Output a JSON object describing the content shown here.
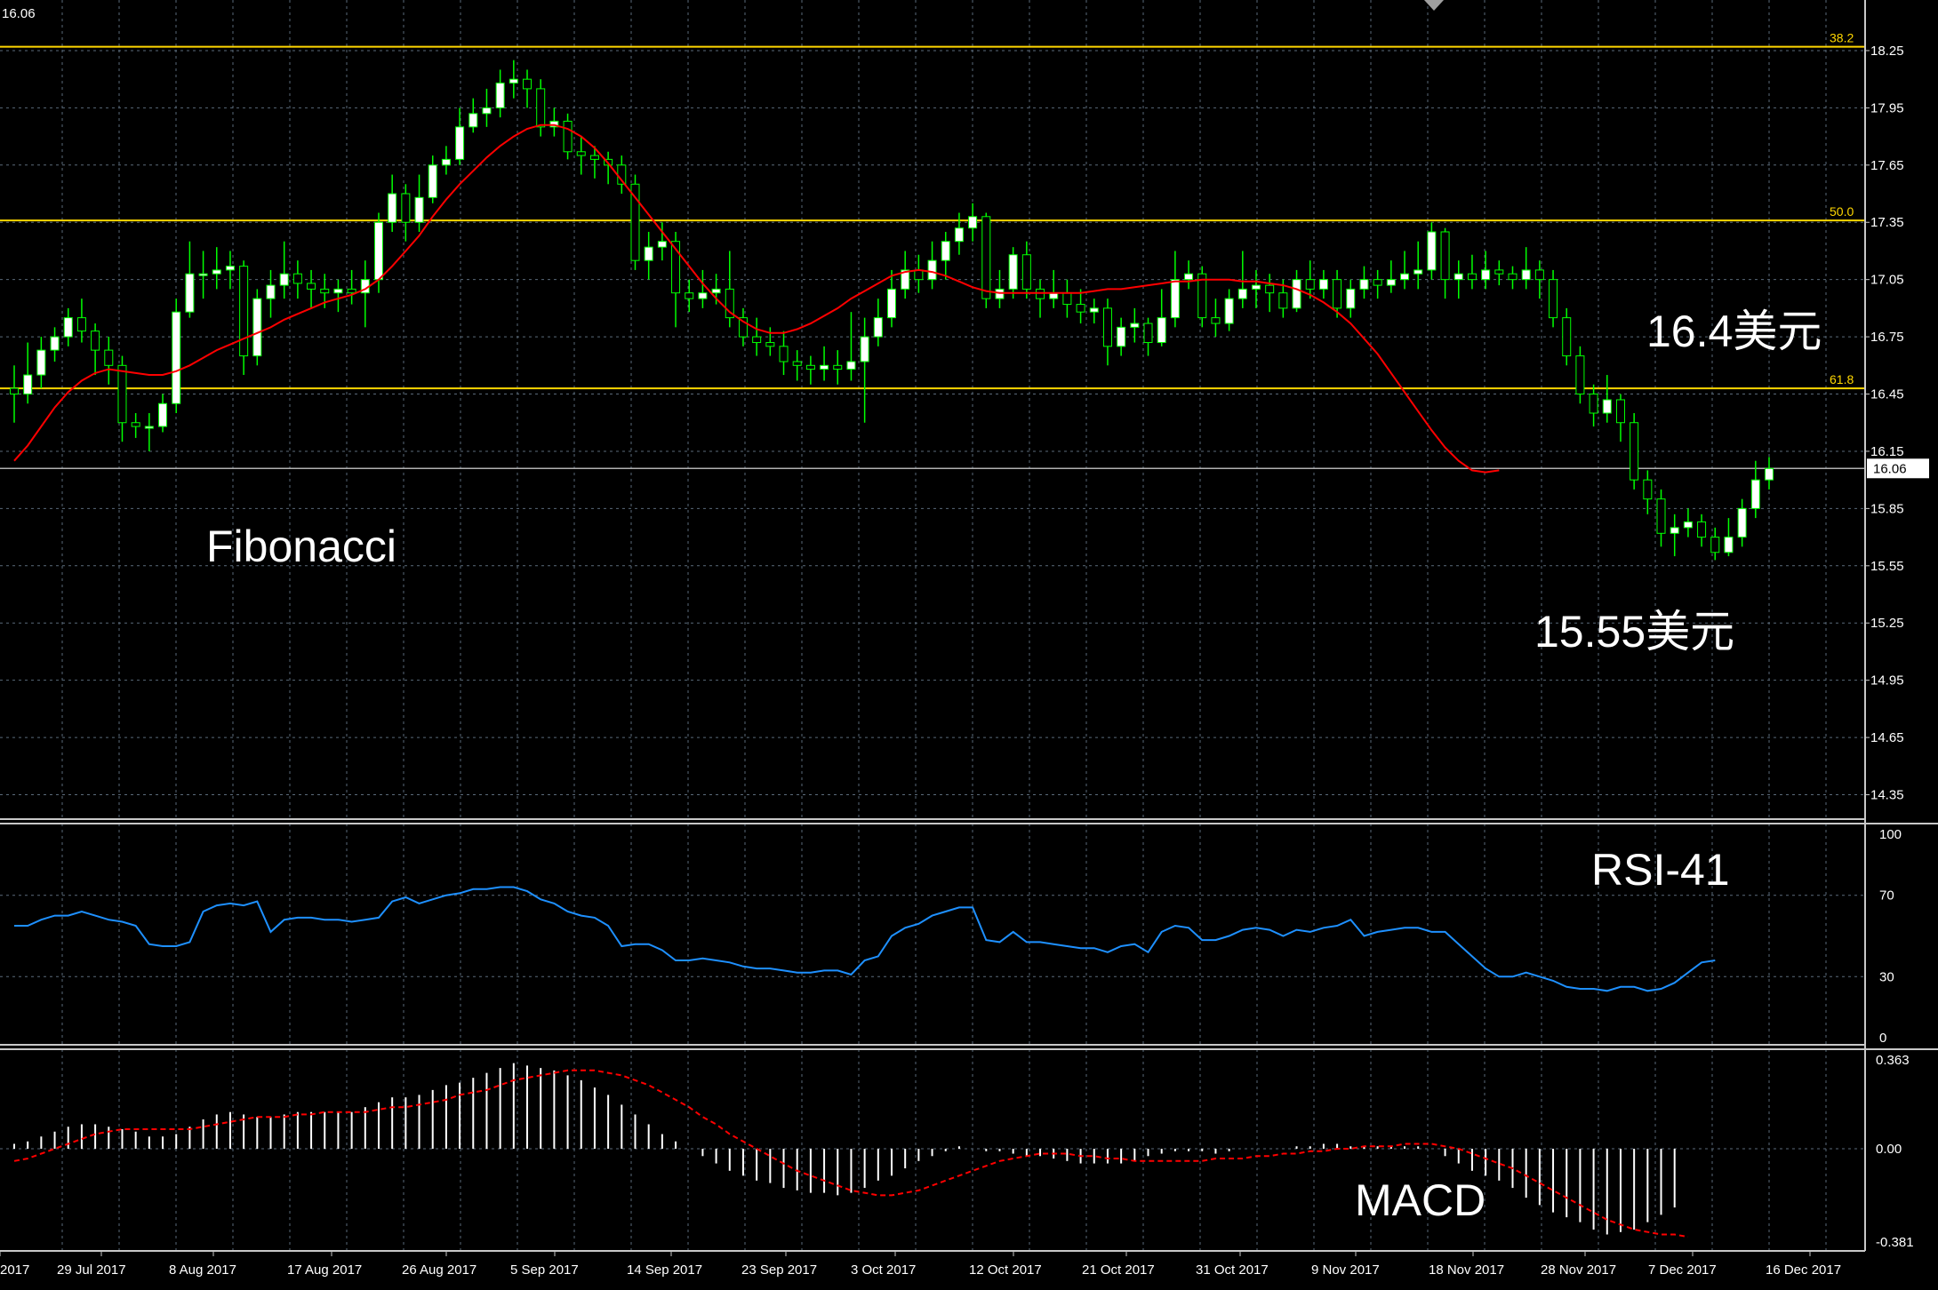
{
  "chart_data": {
    "type": "candlestick",
    "symbol_price_label": "16.06",
    "x_dates": [
      "2017",
      "29 Jul 2017",
      "8 Aug 2017",
      "17 Aug 2017",
      "26 Aug 2017",
      "5 Sep 2017",
      "14 Sep 2017",
      "23 Sep 2017",
      "3 Oct 2017",
      "12 Oct 2017",
      "21 Oct 2017",
      "31 Oct 2017",
      "9 Nov 2017",
      "18 Nov 2017",
      "28 Nov 2017",
      "7 Dec 2017",
      "16 Dec 2017"
    ],
    "price_axis": {
      "ylim": [
        14.25,
        18.45
      ],
      "ticks": [
        "18.25",
        "17.95",
        "17.65",
        "17.35",
        "17.05",
        "16.75",
        "16.45",
        "16.15",
        "15.85",
        "15.55",
        "15.25",
        "14.95",
        "14.65",
        "14.35"
      ],
      "current_price": 16.06,
      "current_label": "16.06"
    },
    "fibonacci": [
      {
        "label": "38.2",
        "price": 18.27
      },
      {
        "label": "50.0",
        "price": 17.36
      },
      {
        "label": "61.8",
        "price": 16.48
      }
    ],
    "candles": [
      [
        16.48,
        16.45,
        16.6,
        16.3
      ],
      [
        16.45,
        16.55,
        16.72,
        16.4
      ],
      [
        16.55,
        16.68,
        16.75,
        16.48
      ],
      [
        16.68,
        16.75,
        16.8,
        16.62
      ],
      [
        16.75,
        16.85,
        16.9,
        16.7
      ],
      [
        16.85,
        16.78,
        16.95,
        16.72
      ],
      [
        16.78,
        16.68,
        16.82,
        16.55
      ],
      [
        16.68,
        16.6,
        16.75,
        16.5
      ],
      [
        16.6,
        16.3,
        16.65,
        16.2
      ],
      [
        16.3,
        16.28,
        16.35,
        16.22
      ],
      [
        16.28,
        16.28,
        16.35,
        16.15
      ],
      [
        16.28,
        16.4,
        16.45,
        16.25
      ],
      [
        16.4,
        16.88,
        16.95,
        16.35
      ],
      [
        16.88,
        17.08,
        17.25,
        16.85
      ],
      [
        17.08,
        17.08,
        17.2,
        16.95
      ],
      [
        17.08,
        17.1,
        17.22,
        17.0
      ],
      [
        17.1,
        17.12,
        17.2,
        17.0
      ],
      [
        17.12,
        16.65,
        17.15,
        16.55
      ],
      [
        16.65,
        16.95,
        17.0,
        16.6
      ],
      [
        16.95,
        17.02,
        17.1,
        16.85
      ],
      [
        17.02,
        17.08,
        17.25,
        16.95
      ],
      [
        17.08,
        17.03,
        17.15,
        16.95
      ],
      [
        17.03,
        17.0,
        17.1,
        16.9
      ],
      [
        17.0,
        16.98,
        17.08,
        16.9
      ],
      [
        16.98,
        17.0,
        17.05,
        16.88
      ],
      [
        17.0,
        16.98,
        17.1,
        16.92
      ],
      [
        16.98,
        17.05,
        17.15,
        16.8
      ],
      [
        17.05,
        17.35,
        17.4,
        16.98
      ],
      [
        17.35,
        17.5,
        17.6,
        17.3
      ],
      [
        17.5,
        17.35,
        17.55,
        17.25
      ],
      [
        17.35,
        17.48,
        17.6,
        17.3
      ],
      [
        17.48,
        17.65,
        17.7,
        17.45
      ],
      [
        17.65,
        17.68,
        17.75,
        17.6
      ],
      [
        17.68,
        17.85,
        17.95,
        17.65
      ],
      [
        17.85,
        17.92,
        18.0,
        17.82
      ],
      [
        17.92,
        17.95,
        18.05,
        17.85
      ],
      [
        17.95,
        18.08,
        18.15,
        17.9
      ],
      [
        18.08,
        18.1,
        18.2,
        18.0
      ],
      [
        18.1,
        18.05,
        18.15,
        17.95
      ],
      [
        18.05,
        17.85,
        18.1,
        17.8
      ],
      [
        17.85,
        17.88,
        17.95,
        17.8
      ],
      [
        17.88,
        17.72,
        17.92,
        17.68
      ],
      [
        17.72,
        17.7,
        17.8,
        17.6
      ],
      [
        17.7,
        17.68,
        17.75,
        17.58
      ],
      [
        17.68,
        17.65,
        17.72,
        17.55
      ],
      [
        17.65,
        17.55,
        17.7,
        17.5
      ],
      [
        17.55,
        17.15,
        17.6,
        17.1
      ],
      [
        17.15,
        17.22,
        17.3,
        17.05
      ],
      [
        17.22,
        17.25,
        17.35,
        17.15
      ],
      [
        17.25,
        16.98,
        17.3,
        16.8
      ],
      [
        16.98,
        16.95,
        17.05,
        16.88
      ],
      [
        16.95,
        16.98,
        17.1,
        16.9
      ],
      [
        16.98,
        17.0,
        17.08,
        16.92
      ],
      [
        17.0,
        16.85,
        17.2,
        16.8
      ],
      [
        16.85,
        16.75,
        16.9,
        16.7
      ],
      [
        16.75,
        16.72,
        16.85,
        16.65
      ],
      [
        16.72,
        16.7,
        16.8,
        16.65
      ],
      [
        16.7,
        16.62,
        16.78,
        16.55
      ],
      [
        16.62,
        16.6,
        16.68,
        16.52
      ],
      [
        16.6,
        16.58,
        16.65,
        16.5
      ],
      [
        16.58,
        16.6,
        16.7,
        16.52
      ],
      [
        16.6,
        16.58,
        16.68,
        16.5
      ],
      [
        16.58,
        16.62,
        16.88,
        16.52
      ],
      [
        16.62,
        16.75,
        16.85,
        16.3
      ],
      [
        16.75,
        16.85,
        16.95,
        16.7
      ],
      [
        16.85,
        17.0,
        17.1,
        16.8
      ],
      [
        17.0,
        17.1,
        17.2,
        16.95
      ],
      [
        17.1,
        17.05,
        17.18,
        16.98
      ],
      [
        17.05,
        17.15,
        17.25,
        17.0
      ],
      [
        17.15,
        17.25,
        17.3,
        17.05
      ],
      [
        17.25,
        17.32,
        17.4,
        17.18
      ],
      [
        17.32,
        17.38,
        17.45,
        17.25
      ],
      [
        17.38,
        16.95,
        17.4,
        16.9
      ],
      [
        16.95,
        17.0,
        17.1,
        16.9
      ],
      [
        17.0,
        17.18,
        17.22,
        16.95
      ],
      [
        17.18,
        17.0,
        17.25,
        16.95
      ],
      [
        17.0,
        16.95,
        17.05,
        16.85
      ],
      [
        16.95,
        16.98,
        17.1,
        16.9
      ],
      [
        16.98,
        16.92,
        17.05,
        16.85
      ],
      [
        16.92,
        16.88,
        17.0,
        16.82
      ],
      [
        16.88,
        16.9,
        16.95,
        16.82
      ],
      [
        16.9,
        16.7,
        16.95,
        16.6
      ],
      [
        16.7,
        16.8,
        16.85,
        16.65
      ],
      [
        16.8,
        16.82,
        16.9,
        16.72
      ],
      [
        16.82,
        16.72,
        16.85,
        16.65
      ],
      [
        16.72,
        16.85,
        17.0,
        16.7
      ],
      [
        16.85,
        17.05,
        17.2,
        16.8
      ],
      [
        17.05,
        17.08,
        17.15,
        17.0
      ],
      [
        17.08,
        16.85,
        17.12,
        16.8
      ],
      [
        16.85,
        16.82,
        16.95,
        16.75
      ],
      [
        16.82,
        16.95,
        17.0,
        16.78
      ],
      [
        16.95,
        17.0,
        17.2,
        16.9
      ],
      [
        17.0,
        17.02,
        17.1,
        16.9
      ],
      [
        17.02,
        16.98,
        17.08,
        16.88
      ],
      [
        16.98,
        16.9,
        17.05,
        16.85
      ],
      [
        16.9,
        17.05,
        17.1,
        16.88
      ],
      [
        17.05,
        17.0,
        17.15,
        16.95
      ],
      [
        17.0,
        17.05,
        17.1,
        16.95
      ],
      [
        17.05,
        16.9,
        17.1,
        16.85
      ],
      [
        16.9,
        17.0,
        17.05,
        16.85
      ],
      [
        17.0,
        17.05,
        17.12,
        16.95
      ],
      [
        17.05,
        17.02,
        17.1,
        16.95
      ],
      [
        17.02,
        17.05,
        17.15,
        16.98
      ],
      [
        17.05,
        17.08,
        17.2,
        17.0
      ],
      [
        17.08,
        17.1,
        17.25,
        17.0
      ],
      [
        17.1,
        17.3,
        17.35,
        17.05
      ],
      [
        17.3,
        17.05,
        17.32,
        16.95
      ],
      [
        17.05,
        17.08,
        17.15,
        16.95
      ],
      [
        17.08,
        17.05,
        17.18,
        17.0
      ],
      [
        17.05,
        17.1,
        17.2,
        17.0
      ],
      [
        17.1,
        17.08,
        17.15,
        17.02
      ],
      [
        17.08,
        17.05,
        17.12,
        17.0
      ],
      [
        17.05,
        17.1,
        17.22,
        17.0
      ],
      [
        17.1,
        17.05,
        17.15,
        16.95
      ],
      [
        17.05,
        16.85,
        17.1,
        16.8
      ],
      [
        16.85,
        16.65,
        16.9,
        16.6
      ],
      [
        16.65,
        16.45,
        16.7,
        16.4
      ],
      [
        16.45,
        16.35,
        16.5,
        16.28
      ],
      [
        16.35,
        16.42,
        16.55,
        16.3
      ],
      [
        16.42,
        16.3,
        16.45,
        16.2
      ],
      [
        16.3,
        16.0,
        16.35,
        15.95
      ],
      [
        16.0,
        15.9,
        16.05,
        15.82
      ],
      [
        15.9,
        15.72,
        15.95,
        15.65
      ],
      [
        15.72,
        15.75,
        15.82,
        15.6
      ],
      [
        15.75,
        15.78,
        15.85,
        15.7
      ],
      [
        15.78,
        15.7,
        15.82,
        15.65
      ],
      [
        15.7,
        15.62,
        15.75,
        15.58
      ],
      [
        15.62,
        15.7,
        15.8,
        15.6
      ],
      [
        15.7,
        15.85,
        15.9,
        15.65
      ],
      [
        15.85,
        16.0,
        16.1,
        15.8
      ],
      [
        16.0,
        16.06,
        16.12,
        15.95
      ]
    ],
    "ma": [
      16.1,
      16.18,
      16.28,
      16.38,
      16.46,
      16.52,
      16.56,
      16.58,
      16.57,
      16.56,
      16.55,
      16.55,
      16.57,
      16.6,
      16.64,
      16.68,
      16.71,
      16.74,
      16.77,
      16.8,
      16.84,
      16.87,
      16.9,
      16.93,
      16.95,
      16.97,
      17.0,
      17.05,
      17.12,
      17.2,
      17.28,
      17.38,
      17.47,
      17.55,
      17.62,
      17.69,
      17.75,
      17.8,
      17.84,
      17.86,
      17.86,
      17.84,
      17.8,
      17.74,
      17.66,
      17.57,
      17.48,
      17.39,
      17.3,
      17.21,
      17.12,
      17.03,
      16.95,
      16.88,
      16.83,
      16.79,
      16.77,
      16.77,
      16.79,
      16.82,
      16.86,
      16.9,
      16.95,
      16.99,
      17.03,
      17.07,
      17.09,
      17.1,
      17.09,
      17.07,
      17.04,
      17.01,
      16.99,
      16.98,
      16.98,
      16.98,
      16.98,
      16.98,
      16.98,
      16.98,
      16.99,
      17.0,
      17.0,
      17.01,
      17.02,
      17.03,
      17.04,
      17.04,
      17.05,
      17.05,
      17.05,
      17.04,
      17.04,
      17.03,
      17.02,
      17.0,
      16.97,
      16.93,
      16.88,
      16.82,
      16.74,
      16.66,
      16.56,
      16.46,
      16.36,
      16.26,
      16.17,
      16.1,
      16.05,
      16.04,
      16.05
    ],
    "rsi": {
      "title": "RSI-41",
      "ylim": [
        0,
        100
      ],
      "ticks": [
        "100",
        "70",
        "30",
        "0"
      ],
      "values": [
        55,
        55,
        58,
        60,
        60,
        62,
        60,
        58,
        57,
        55,
        46,
        45,
        45,
        47,
        62,
        65,
        66,
        65,
        67,
        52,
        58,
        59,
        59,
        58,
        58,
        57,
        58,
        59,
        67,
        69,
        66,
        68,
        70,
        71,
        73,
        73,
        74,
        74,
        72,
        68,
        66,
        62,
        60,
        59,
        55,
        45,
        46,
        46,
        43,
        38,
        38,
        39,
        38,
        37,
        35,
        34,
        34,
        33,
        32,
        32,
        33,
        33,
        31,
        38,
        40,
        50,
        54,
        56,
        60,
        62,
        64,
        64,
        48,
        47,
        52,
        47,
        47,
        46,
        45,
        44,
        44,
        42,
        45,
        46,
        42,
        52,
        55,
        54,
        48,
        48,
        50,
        53,
        54,
        53,
        50,
        53,
        52,
        54,
        55,
        58,
        50,
        52,
        53,
        54,
        54,
        52,
        52,
        46,
        40,
        34,
        30,
        30,
        32,
        30,
        28,
        25,
        24,
        24,
        23,
        25,
        25,
        23,
        24,
        27,
        32,
        37,
        38
      ],
      "color": "#1e90ff"
    },
    "macd": {
      "title": "MACD",
      "ylim": [
        -0.381,
        0.363
      ],
      "ticks": [
        "0.363",
        "0.00",
        "-0.381"
      ],
      "histogram": [
        0.02,
        0.03,
        0.05,
        0.07,
        0.09,
        0.1,
        0.1,
        0.09,
        0.08,
        0.07,
        0.05,
        0.05,
        0.06,
        0.09,
        0.12,
        0.14,
        0.15,
        0.14,
        0.13,
        0.13,
        0.14,
        0.15,
        0.15,
        0.15,
        0.15,
        0.15,
        0.17,
        0.19,
        0.21,
        0.21,
        0.22,
        0.24,
        0.26,
        0.27,
        0.29,
        0.31,
        0.33,
        0.35,
        0.34,
        0.33,
        0.32,
        0.3,
        0.28,
        0.25,
        0.22,
        0.18,
        0.14,
        0.1,
        0.06,
        0.03,
        0.0,
        -0.03,
        -0.06,
        -0.09,
        -0.11,
        -0.13,
        -0.14,
        -0.16,
        -0.17,
        -0.18,
        -0.18,
        -0.19,
        -0.18,
        -0.16,
        -0.13,
        -0.11,
        -0.08,
        -0.05,
        -0.03,
        -0.01,
        0.01,
        0.0,
        -0.01,
        -0.01,
        -0.02,
        -0.03,
        -0.03,
        -0.04,
        -0.05,
        -0.06,
        -0.06,
        -0.06,
        -0.06,
        -0.05,
        -0.03,
        -0.02,
        -0.01,
        -0.01,
        -0.01,
        -0.02,
        -0.01,
        0.0,
        0.0,
        0.0,
        0.0,
        0.01,
        0.01,
        0.02,
        0.02,
        0.01,
        0.01,
        0.01,
        0.01,
        0.01,
        0.01,
        0.0,
        -0.03,
        -0.06,
        -0.09,
        -0.11,
        -0.13,
        -0.16,
        -0.2,
        -0.23,
        -0.26,
        -0.28,
        -0.3,
        -0.33,
        -0.35,
        -0.34,
        -0.33,
        -0.3,
        -0.27,
        -0.24
      ],
      "signal": [
        -0.05,
        -0.04,
        -0.02,
        0.0,
        0.02,
        0.04,
        0.06,
        0.07,
        0.08,
        0.08,
        0.08,
        0.08,
        0.08,
        0.08,
        0.09,
        0.1,
        0.11,
        0.12,
        0.13,
        0.13,
        0.13,
        0.14,
        0.14,
        0.15,
        0.15,
        0.15,
        0.15,
        0.16,
        0.17,
        0.17,
        0.18,
        0.19,
        0.2,
        0.22,
        0.23,
        0.24,
        0.26,
        0.28,
        0.29,
        0.3,
        0.31,
        0.32,
        0.32,
        0.32,
        0.31,
        0.3,
        0.28,
        0.26,
        0.23,
        0.2,
        0.17,
        0.13,
        0.1,
        0.06,
        0.03,
        0.0,
        -0.03,
        -0.06,
        -0.09,
        -0.11,
        -0.13,
        -0.15,
        -0.17,
        -0.18,
        -0.19,
        -0.19,
        -0.18,
        -0.17,
        -0.15,
        -0.13,
        -0.11,
        -0.09,
        -0.07,
        -0.05,
        -0.04,
        -0.03,
        -0.02,
        -0.02,
        -0.02,
        -0.03,
        -0.03,
        -0.04,
        -0.04,
        -0.05,
        -0.05,
        -0.05,
        -0.05,
        -0.05,
        -0.05,
        -0.04,
        -0.04,
        -0.04,
        -0.03,
        -0.03,
        -0.02,
        -0.02,
        -0.01,
        -0.01,
        0.0,
        0.0,
        0.01,
        0.01,
        0.01,
        0.02,
        0.02,
        0.02,
        0.01,
        0.0,
        -0.02,
        -0.04,
        -0.06,
        -0.08,
        -0.11,
        -0.14,
        -0.17,
        -0.2,
        -0.23,
        -0.26,
        -0.29,
        -0.31,
        -0.33,
        -0.34,
        -0.35,
        -0.35,
        -0.36
      ]
    },
    "annotations": {
      "fibonacci_label": "Fibonacci",
      "resistance_label": "16.4美元",
      "support_label": "15.55美元"
    },
    "colors": {
      "background": "#000000",
      "grid": "#5a6a7a",
      "bull_candle": "#ffffff",
      "bear_candle": "#000000",
      "wick": "#00ff00",
      "ma_line": "#ff0000",
      "fib_line": "#ffd700",
      "price_line": "#b0b0b0",
      "macd_hist": "#ffffff",
      "macd_signal": "#ff0000"
    }
  }
}
